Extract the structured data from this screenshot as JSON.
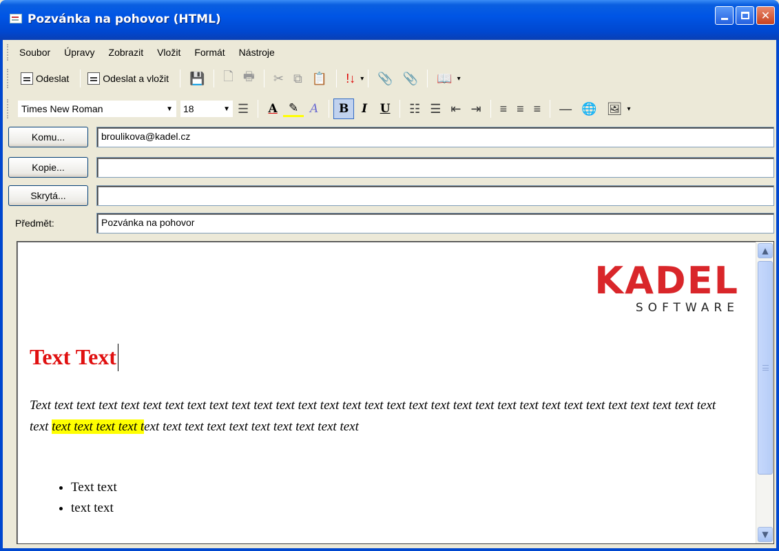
{
  "window": {
    "title": "Pozvánka na pohovor (HTML)",
    "accent": "#0055e5"
  },
  "menu": {
    "items": [
      "Soubor",
      "Úpravy",
      "Zobrazit",
      "Vložit",
      "Formát",
      "Nástroje"
    ]
  },
  "toolbar": {
    "send_label": "Odeslat",
    "send_insert_label": "Odeslat a vložit"
  },
  "format": {
    "font": "Times New Roman",
    "size": "18"
  },
  "fields": {
    "to_button": "Komu...",
    "to_value": "broulikova@kadel.cz",
    "cc_button": "Kopie...",
    "cc_value": "",
    "bcc_button": "Skrytá...",
    "bcc_value": "",
    "subject_label": "Předmět:",
    "subject_value": "Pozvánka na pohovor"
  },
  "body": {
    "logo_main": "KADEL",
    "logo_sub": "SOFTWARE",
    "heading": "Text Text",
    "para_before": "Text text text text text text  text text text text text  text text text text text  text text text text text text text text text text  text text text text text  text ",
    "para_highlight": "text text text text  t",
    "para_after": "ext text text text text  text text text text text",
    "bullets": [
      "Text text",
      "text text"
    ],
    "heading_color": "#e01010",
    "highlight_color": "#ffff00",
    "logo_color": "#d9262a"
  }
}
